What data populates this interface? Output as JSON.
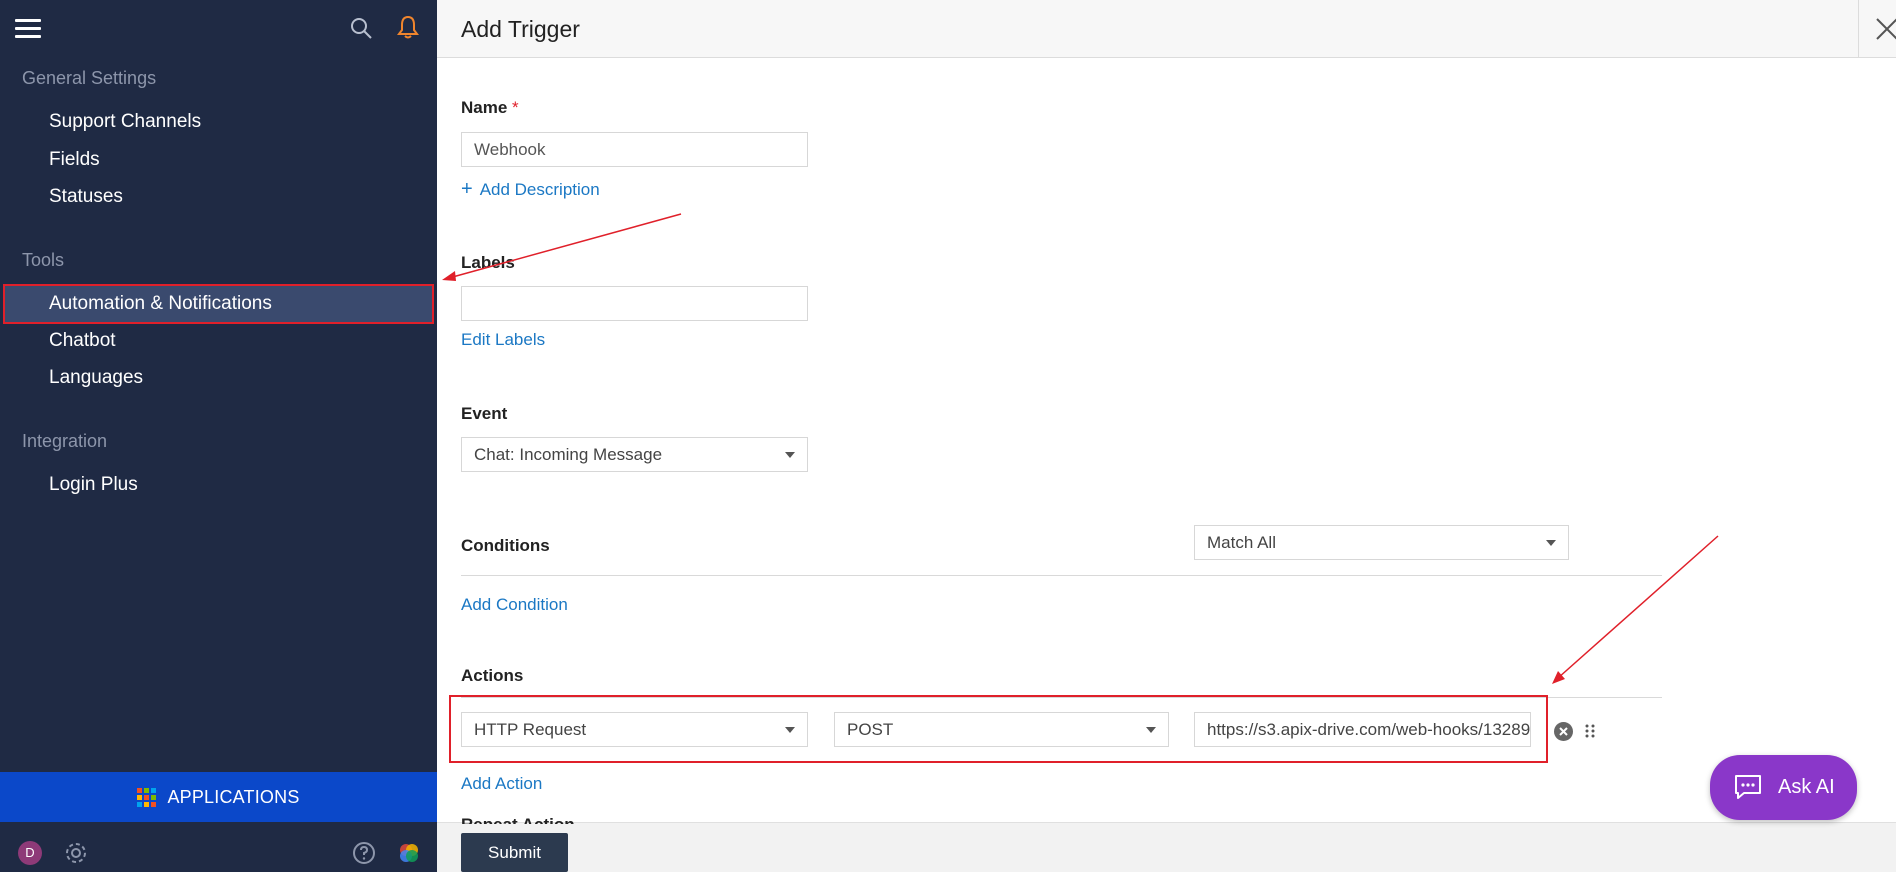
{
  "sidebar": {
    "sections": [
      {
        "title": "General Settings",
        "items": [
          "Support Channels",
          "Fields",
          "Statuses"
        ]
      },
      {
        "title": "Tools",
        "items": [
          "Automation & Notifications",
          "Chatbot",
          "Languages"
        ]
      },
      {
        "title": "Integration",
        "items": [
          "Login Plus"
        ]
      }
    ],
    "active_item": "Automation & Notifications",
    "applications_label": "APPLICATIONS",
    "avatar_initial": "D",
    "icons": [
      "menu-icon",
      "search-icon",
      "bell-icon",
      "gear-icon",
      "help-icon"
    ]
  },
  "header": {
    "title": "Add Trigger"
  },
  "form": {
    "name_label": "Name",
    "name_required_mark": "*",
    "name_value": "Webhook",
    "add_description": "Add Description",
    "labels_label": "Labels",
    "labels_value": "",
    "edit_labels": "Edit Labels",
    "event_label": "Event",
    "event_value": "Chat: Incoming Message",
    "conditions_label": "Conditions",
    "conditions_match": "Match All",
    "add_condition": "Add Condition",
    "actions_label": "Actions",
    "action_type": "HTTP Request",
    "action_method": "POST",
    "action_url": "https://s3.apix-drive.com/web-hooks/13289",
    "add_action": "Add Action",
    "repeat_action_label": "Repeat Action",
    "submit": "Submit"
  },
  "ask_ai": "Ask AI",
  "colors": {
    "sidebar_bg": "#1f2a44",
    "apps_bar": "#0b48c9",
    "link": "#1b78c4",
    "annotation_red": "#e0202a",
    "ask_ai_bg": "#8a37c9",
    "submit_bg": "#2c3a4f"
  }
}
